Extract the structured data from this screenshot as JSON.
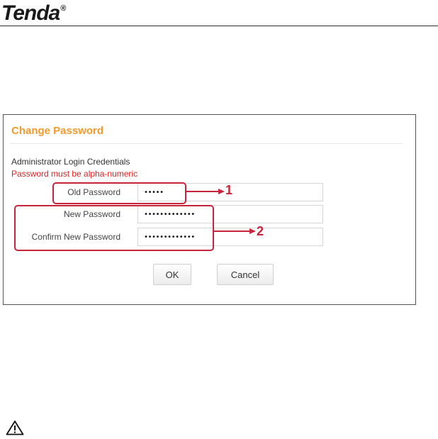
{
  "header": {
    "logo_text": "Tenda",
    "logo_mark": "®"
  },
  "panel": {
    "title": "Change Password",
    "section_label": "Administrator Login Credentials",
    "warning": "Password must be alpha-numeric",
    "fields": {
      "old_password": {
        "label": "Old Password",
        "value": "•••••"
      },
      "new_password": {
        "label": "New Password",
        "value": "•••••••••••••"
      },
      "confirm_password": {
        "label": "Confirm New Password",
        "value": "•••••••••••••"
      }
    },
    "buttons": {
      "ok": "OK",
      "cancel": "Cancel"
    }
  },
  "annotations": {
    "callout_1": "1",
    "callout_2": "2",
    "color": "#c8243b"
  },
  "colors": {
    "title": "#f39a2e",
    "warning": "#e02020"
  },
  "footer": {
    "icon": "warning-triangle-icon"
  }
}
